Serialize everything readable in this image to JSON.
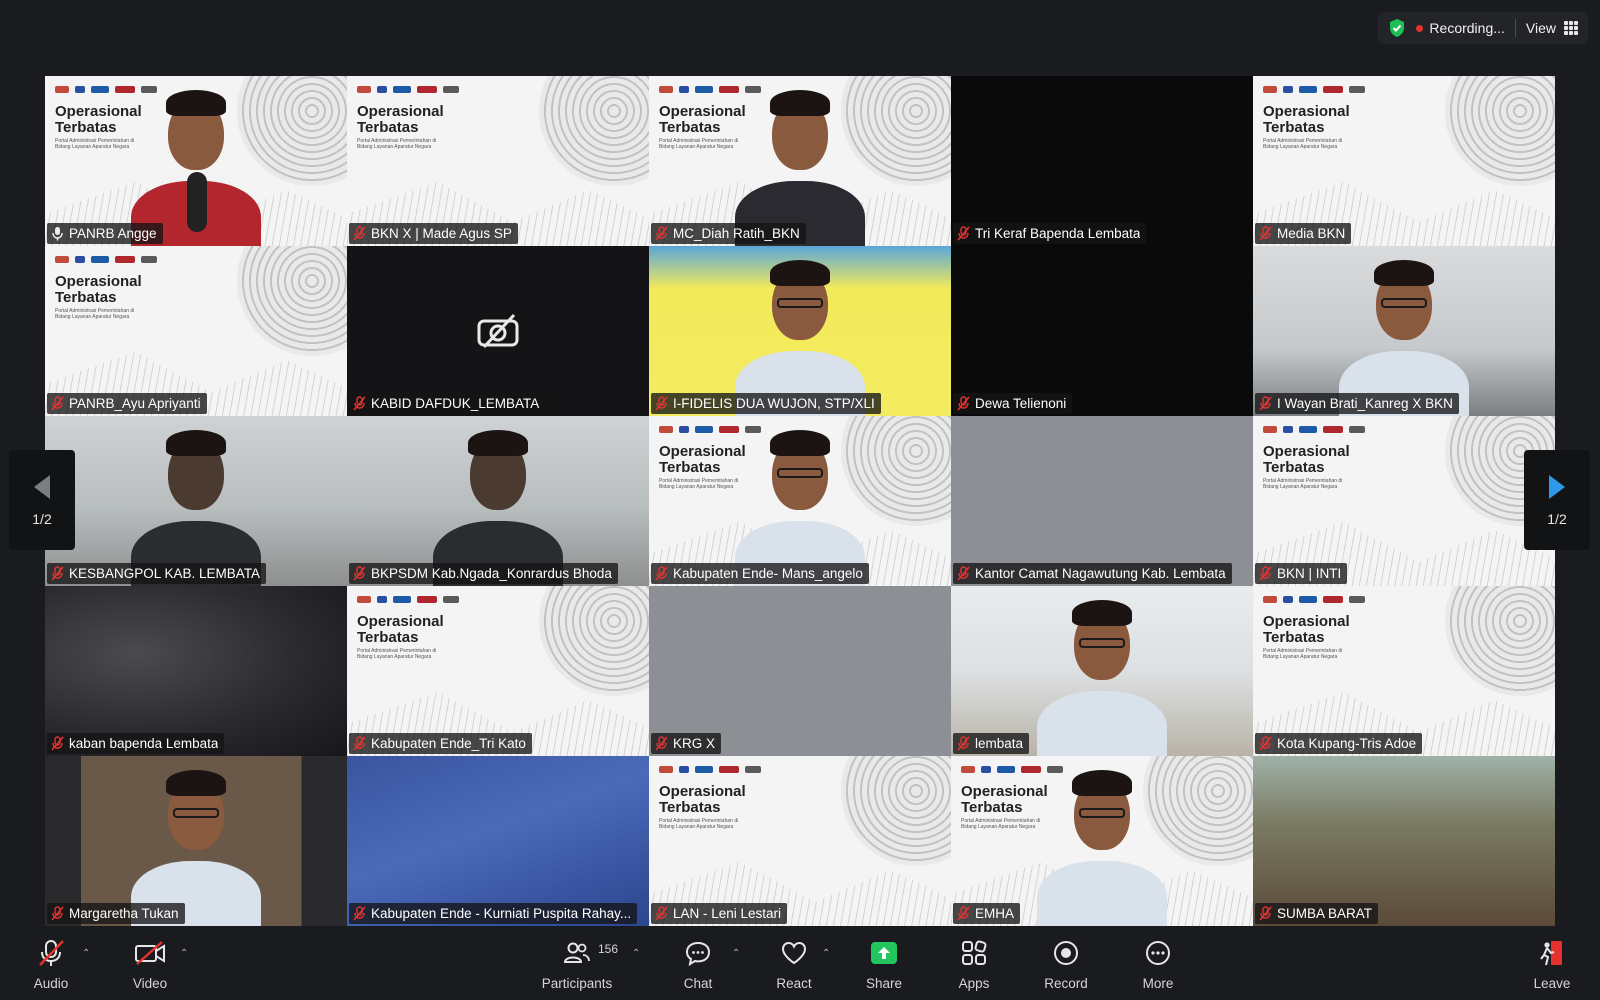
{
  "top": {
    "recording_label": "Recording...",
    "view_label": "View"
  },
  "participants": [
    {
      "name": "PANRB Angge",
      "bg": "slide",
      "person": "speaker",
      "mic": "pin",
      "active": true
    },
    {
      "name": "BKN X | Made Agus SP",
      "bg": "slide",
      "mic": "muted"
    },
    {
      "name": "MC_Diah Ratih_BKN",
      "bg": "slide",
      "person": "woman",
      "mic": "muted"
    },
    {
      "name": "Tri Keraf Bapenda Lembata",
      "bg": "dark",
      "mic": "muted"
    },
    {
      "name": "Media BKN",
      "bg": "slide",
      "mic": "muted"
    },
    {
      "name": "PANRB_Ayu Apriyanti",
      "bg": "slide",
      "mic": "muted"
    },
    {
      "name": "KABID DAFDUK_LEMBATA",
      "bg": "dark2",
      "camoff": true,
      "mic": "muted"
    },
    {
      "name": "I-FIDELIS DUA WUJON, STP/XLI",
      "bg": "yellow",
      "person": "glasses",
      "mic": "muted"
    },
    {
      "name": "Dewa Telienoni",
      "bg": "dark",
      "mic": "muted"
    },
    {
      "name": "I Wayan Brati_Kanreg X BKN",
      "bg": "room2",
      "person": "man",
      "mic": "muted"
    },
    {
      "name": "KESBANGPOL KAB. LEMBATA",
      "bg": "room",
      "person": "dim",
      "mic": "muted"
    },
    {
      "name": "BKPSDM Kab.Ngada_Konrardus Bhoda",
      "bg": "room",
      "person": "dim",
      "mic": "muted"
    },
    {
      "name": "Kabupaten Ende- Mans_angelo",
      "bg": "slide",
      "person": "phone",
      "mic": "muted"
    },
    {
      "name": "Kantor Camat Nagawutung Kab. Lembata",
      "bg": "grey",
      "mic": "muted"
    },
    {
      "name": "BKN | INTI",
      "bg": "slide",
      "mic": "muted"
    },
    {
      "name": "kaban bapenda Lembata",
      "bg": "blur",
      "mic": "muted"
    },
    {
      "name": "Kabupaten Ende_Tri Kato",
      "bg": "slide",
      "mic": "muted"
    },
    {
      "name": "KRG X",
      "bg": "grey",
      "mic": "muted"
    },
    {
      "name": "lembata",
      "bg": "house",
      "person": "man",
      "mic": "muted"
    },
    {
      "name": "Kota Kupang-Tris Adoe",
      "bg": "slide",
      "mic": "muted"
    },
    {
      "name": "Margaretha Tukan",
      "bg": "library",
      "person": "glasses",
      "mic": "muted"
    },
    {
      "name": "Kabupaten Ende - Kurniati Puspita Rahay...",
      "bg": "blue",
      "mic": "muted"
    },
    {
      "name": "LAN - Leni Lestari",
      "bg": "slide",
      "mic": "muted"
    },
    {
      "name": "EMHA",
      "bg": "slide",
      "person": "man",
      "mic": "muted"
    },
    {
      "name": "SUMBA BARAT",
      "bg": "village",
      "mic": "muted"
    }
  ],
  "slide": {
    "title_line1": "Operasional",
    "title_line2": "Terbatas",
    "subtitle": "Portal Administrasi Pemerintahan di Bidang Layanan Aparatur Negara"
  },
  "pager": {
    "left_label": "1/2",
    "right_label": "1/2"
  },
  "toolbar": {
    "audio": "Audio",
    "video": "Video",
    "participants": "Participants",
    "participants_count": "156",
    "chat": "Chat",
    "react": "React",
    "share": "Share",
    "apps": "Apps",
    "record": "Record",
    "more": "More",
    "leave": "Leave"
  },
  "colors": {
    "active_speaker": "#2ea043",
    "muted_mic": "#e5322e",
    "share_green": "#22c55e",
    "pager_arrow": "#2d9ae8"
  }
}
